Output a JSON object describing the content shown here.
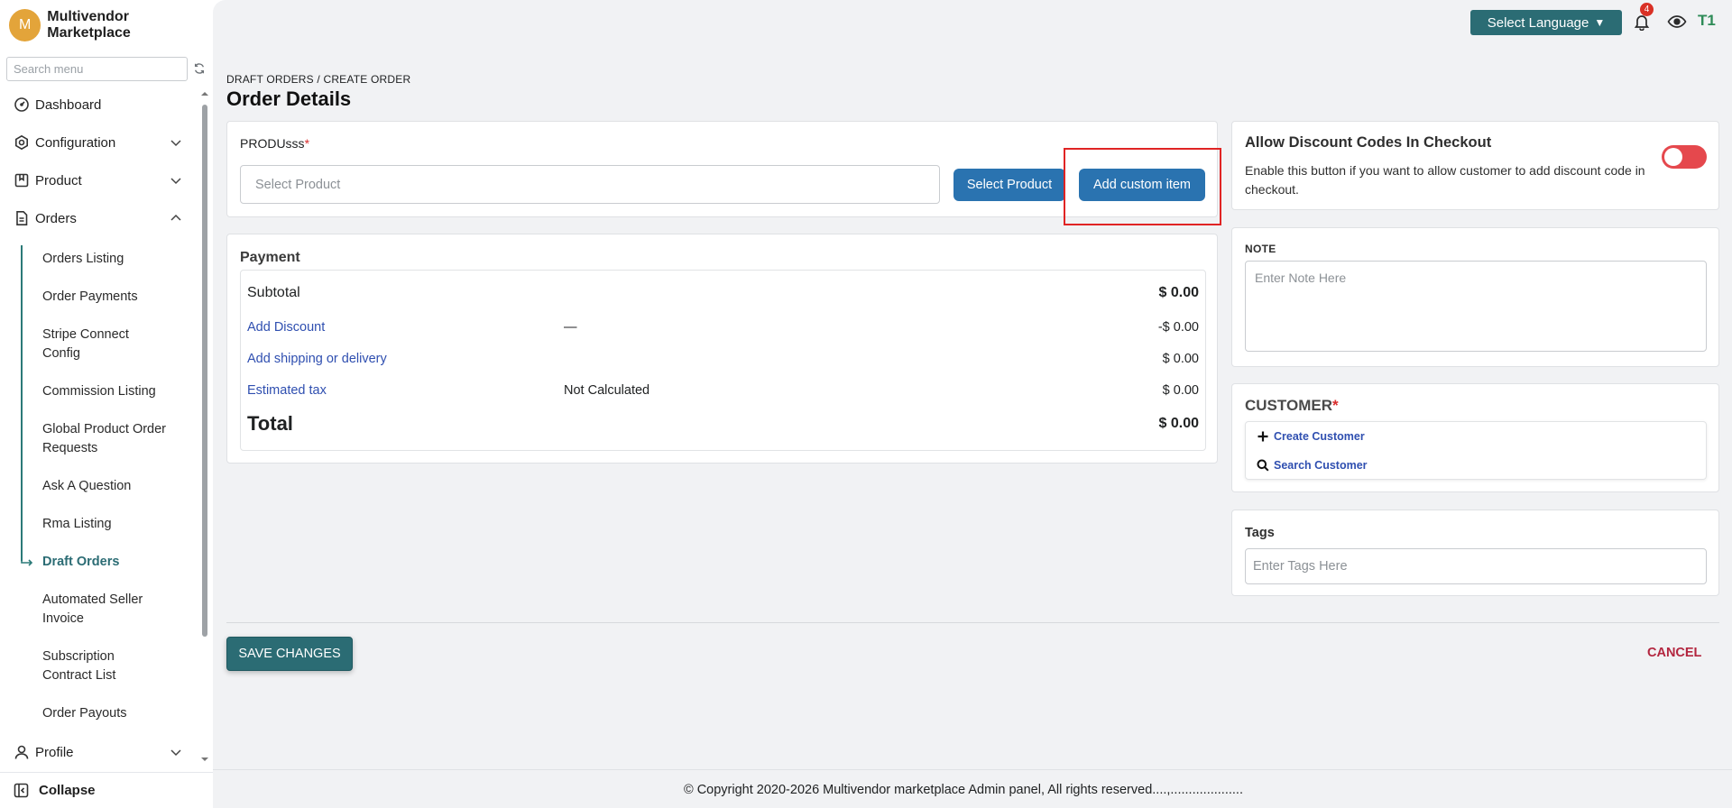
{
  "sidebar": {
    "brand_initial": "M",
    "brand_name": "Multivendor Marketplace",
    "search_placeholder": "Search menu",
    "nav": {
      "dashboard": "Dashboard",
      "configuration": "Configuration",
      "product": "Product",
      "orders": "Orders",
      "profile": "Profile"
    },
    "orders_sub": [
      "Orders Listing",
      "Order Payments",
      "Stripe Connect Config",
      "Commission Listing",
      "Global Product Order Requests",
      "Ask A Question",
      "Rma Listing",
      "Draft Orders",
      "Automated Seller Invoice",
      "Subscription Contract List",
      "Order Payouts"
    ],
    "active_sub": "Draft Orders",
    "collapse_label": "Collapse"
  },
  "topbar": {
    "language_label": "Select Language",
    "notification_count": "4",
    "user_initials": "T1"
  },
  "page": {
    "breadcrumb": "DRAFT ORDERS / CREATE ORDER",
    "title": "Order Details"
  },
  "products": {
    "label": "PRODUsss",
    "required_mark": "*",
    "input_placeholder": "Select Product",
    "select_button": "Select Product",
    "custom_button": "Add custom item"
  },
  "payment": {
    "title": "Payment",
    "subtotal_label": "Subtotal",
    "subtotal_value": "$ 0.00",
    "discount_label": "Add Discount",
    "discount_middle": "—",
    "discount_value": "-$ 0.00",
    "shipping_label": "Add shipping or delivery",
    "shipping_value": "$ 0.00",
    "tax_label": "Estimated tax",
    "tax_middle": "Not Calculated",
    "tax_value": "$ 0.00",
    "total_label": "Total",
    "total_value": "$ 0.00"
  },
  "discount_codes": {
    "title": "Allow Discount Codes In Checkout",
    "description": "Enable this button if you want to allow customer to add discount code in checkout.",
    "enabled": false,
    "toggle_color": "#e5484d"
  },
  "note": {
    "label": "NOTE",
    "placeholder": "Enter Note Here"
  },
  "customer": {
    "title": "CUSTOMER",
    "required_mark": "*",
    "create_label": "Create Customer",
    "search_label": "Search Customer"
  },
  "tags": {
    "label": "Tags",
    "placeholder": "Enter Tags Here"
  },
  "actions": {
    "save_label": "SAVE CHANGES",
    "cancel_label": "CANCEL"
  },
  "footer": {
    "copyright": "© Copyright 2020-2026 Multivendor marketplace Admin panel, All rights reserved....,...................."
  },
  "colors": {
    "primary_teal": "#2b6c74",
    "button_blue": "#2a73b0",
    "link_blue": "#2f4fb0",
    "cancel_red": "#b3263f",
    "highlight_red": "#e02424",
    "brand_orange": "#e3a43a"
  }
}
